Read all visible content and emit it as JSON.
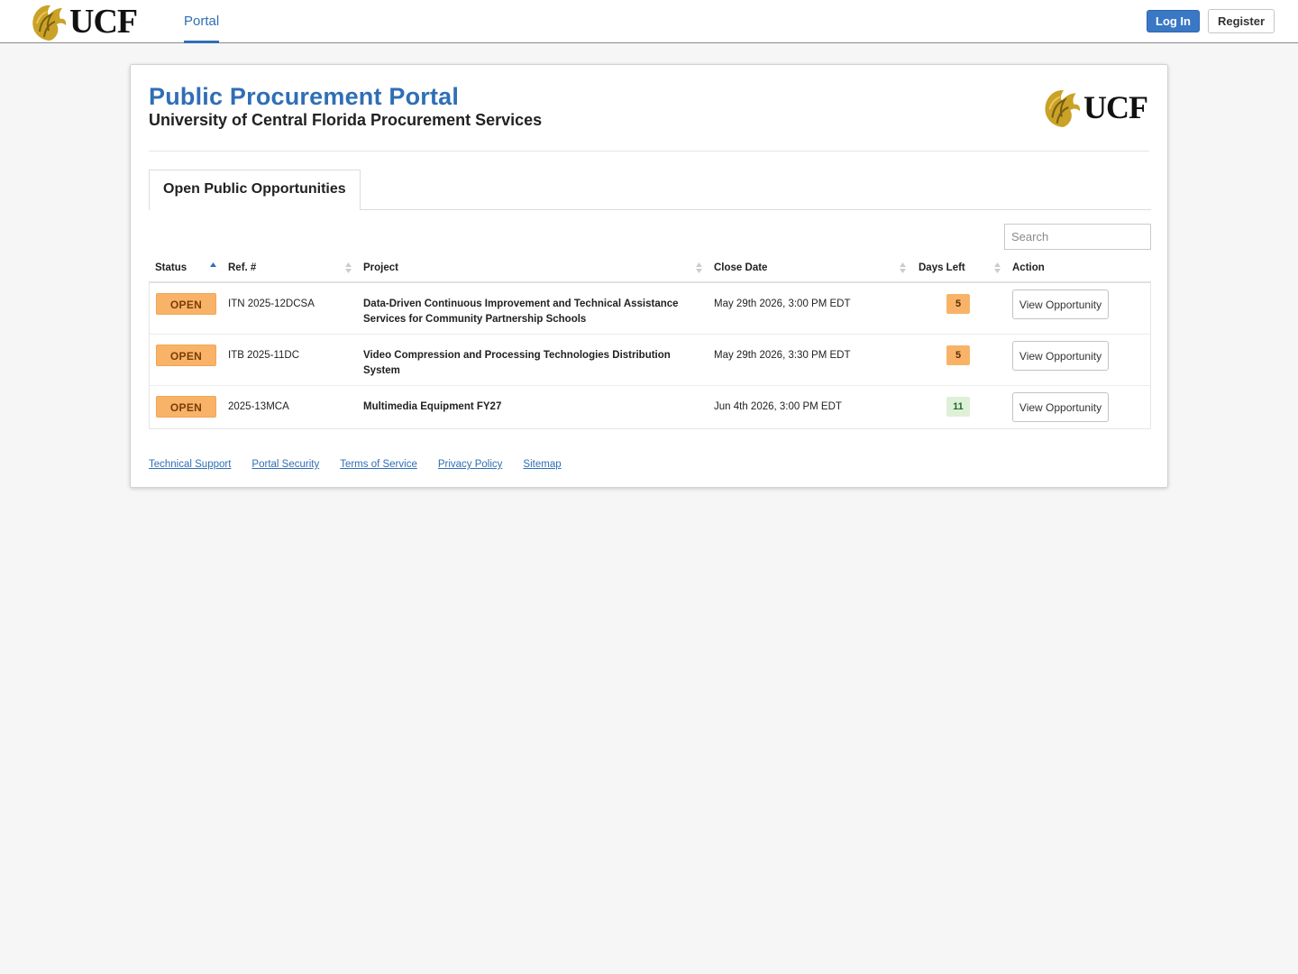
{
  "nav": {
    "logo_text": "UCF",
    "portal_label": "Portal",
    "login_label": "Log In",
    "register_label": "Register"
  },
  "header": {
    "title": "Public Procurement Portal",
    "subtitle": "University of Central Florida Procurement Services",
    "logo_text": "UCF"
  },
  "tabs": [
    {
      "label": "Open Public Opportunities",
      "active": true
    }
  ],
  "search": {
    "placeholder": "Search",
    "value": ""
  },
  "table": {
    "columns": [
      "Status",
      "Ref. #",
      "Project",
      "Close Date",
      "Days Left",
      "Action"
    ],
    "sorted_column": "Status",
    "sort_direction": "ascending",
    "rows": [
      {
        "status": "OPEN",
        "ref": "ITN 2025-12DCSA",
        "project": "Data-Driven Continuous Improvement and Technical Assistance Services for Community Partnership Schools",
        "close_date": "May 29th 2026, 3:00 PM EDT",
        "days_left": "5",
        "action": "View Opportunity"
      },
      {
        "status": "OPEN",
        "ref": "ITB 2025-11DC",
        "project": "Video Compression and Processing Technologies Distribution System",
        "close_date": "May 29th 2026, 3:30 PM EDT",
        "days_left": "5",
        "action": "View Opportunity"
      },
      {
        "status": "OPEN",
        "ref": "2025-13MCA",
        "project": "Multimedia Equipment FY27",
        "close_date": "Jun 4th 2026, 3:00 PM EDT",
        "days_left": "11",
        "action": "View Opportunity"
      }
    ]
  },
  "footer": {
    "links": [
      "Technical Support",
      "Portal Security",
      "Terms of Service",
      "Privacy Policy",
      "Sitemap"
    ]
  },
  "colors": {
    "brand_blue": "#2f6fb5",
    "ucf_gold": "#c9a227",
    "status_open": "#f9b368",
    "days_ok": "#dff0d8"
  },
  "icons": {
    "logo": "pegasus-icon",
    "sort_active": "sort-ascending-icon",
    "sort_inactive": "sort-both-icon"
  }
}
